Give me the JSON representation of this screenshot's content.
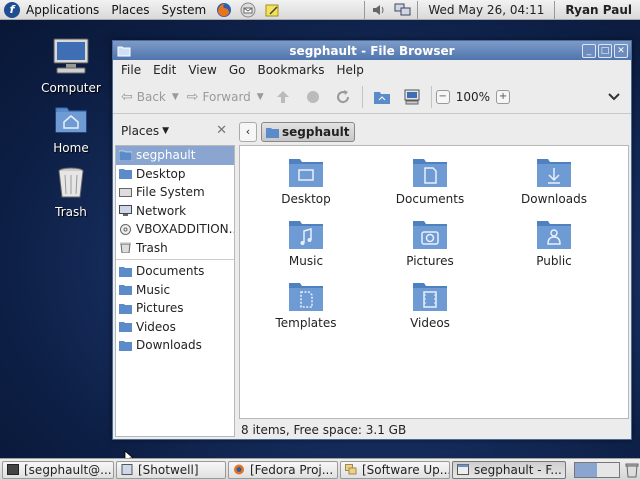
{
  "top_panel": {
    "logo": "f",
    "menus": [
      "Applications",
      "Places",
      "System"
    ],
    "launchers": [
      "firefox-icon",
      "mail-icon",
      "notes-icon"
    ],
    "clock": "Wed May 26, 04:11",
    "user": "Ryan Paul"
  },
  "desktop_icons": [
    {
      "label": "Computer",
      "icon": "computer-icon"
    },
    {
      "label": "Home",
      "icon": "home-folder-icon"
    },
    {
      "label": "Trash",
      "icon": "trash-icon"
    }
  ],
  "window": {
    "title": "segphault - File Browser",
    "menus": [
      "File",
      "Edit",
      "View",
      "Go",
      "Bookmarks",
      "Help"
    ],
    "toolbar": {
      "back": "Back",
      "forward": "Forward",
      "zoom": "100%"
    },
    "sidebar": {
      "header": "Places",
      "items": [
        {
          "label": "segphault",
          "icon": "home-icon",
          "selected": true
        },
        {
          "label": "Desktop",
          "icon": "desktop-icon"
        },
        {
          "label": "File System",
          "icon": "drive-icon"
        },
        {
          "label": "Network",
          "icon": "network-icon"
        },
        {
          "label": "VBOXADDITION...",
          "icon": "disc-icon"
        },
        {
          "label": "Trash",
          "icon": "trash-icon"
        }
      ],
      "bookmarks": [
        {
          "label": "Documents",
          "icon": "folder-icon"
        },
        {
          "label": "Music",
          "icon": "folder-icon"
        },
        {
          "label": "Pictures",
          "icon": "folder-icon"
        },
        {
          "label": "Videos",
          "icon": "folder-icon"
        },
        {
          "label": "Downloads",
          "icon": "folder-icon"
        }
      ]
    },
    "path": "segphault",
    "files": [
      {
        "label": "Desktop",
        "icon": "desktop-folder-icon"
      },
      {
        "label": "Documents",
        "icon": "documents-folder-icon"
      },
      {
        "label": "Downloads",
        "icon": "downloads-folder-icon"
      },
      {
        "label": "Music",
        "icon": "music-folder-icon"
      },
      {
        "label": "Pictures",
        "icon": "pictures-folder-icon"
      },
      {
        "label": "Public",
        "icon": "public-folder-icon"
      },
      {
        "label": "Templates",
        "icon": "templates-folder-icon"
      },
      {
        "label": "Videos",
        "icon": "videos-folder-icon"
      }
    ],
    "status": "8 items, Free space: 3.1 GB"
  },
  "taskbar": {
    "tasks": [
      {
        "label": "[segphault@...",
        "icon": "terminal-icon"
      },
      {
        "label": "[Shotwell]",
        "icon": "shotwell-icon"
      },
      {
        "label": "[Fedora Proj...",
        "icon": "firefox-icon"
      },
      {
        "label": "[Software Up...",
        "icon": "update-icon"
      },
      {
        "label": "segphault - F...",
        "icon": "file-browser-icon",
        "active": true
      }
    ]
  },
  "colors": {
    "selection": "#8aa6d0",
    "titlebar": "#5b7fb5",
    "folder": "#5b8bc8"
  }
}
